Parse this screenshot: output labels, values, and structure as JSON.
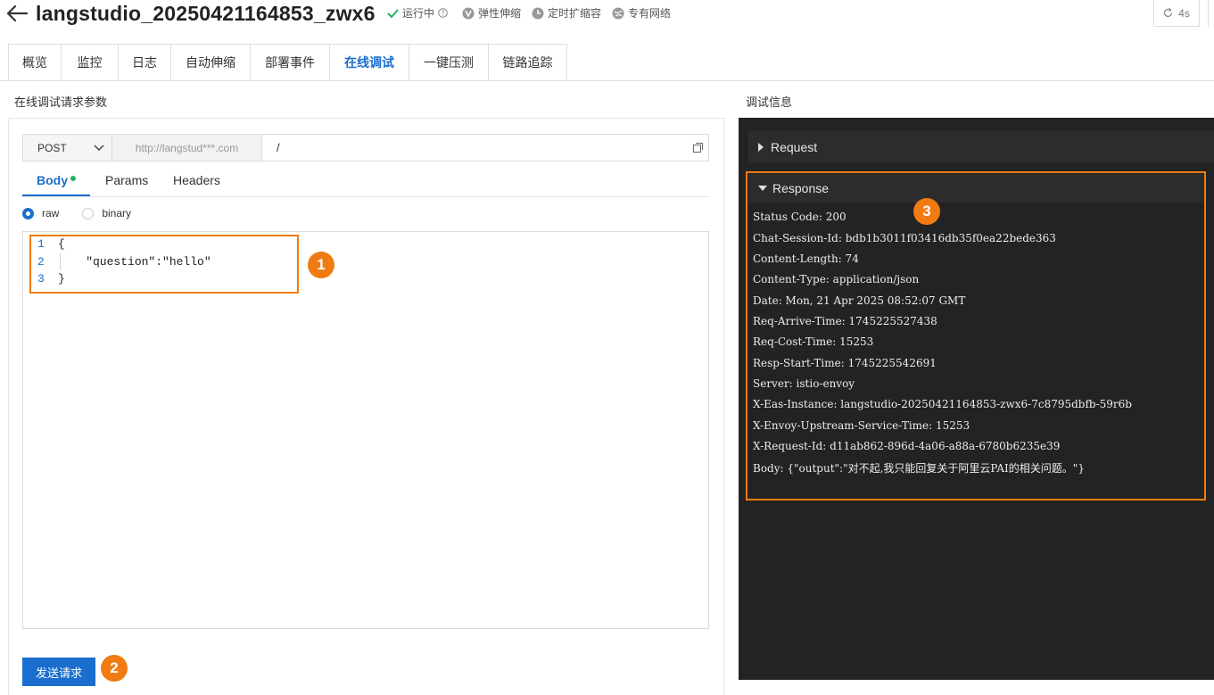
{
  "header": {
    "title": "langstudio_20250421164853_zwx6",
    "status": [
      {
        "label": "运行中",
        "icon": "check-icon"
      },
      {
        "label": "弹性伸缩",
        "icon": "scale-icon"
      },
      {
        "label": "定时扩缩容",
        "icon": "clock-icon"
      },
      {
        "label": "专有网络",
        "icon": "globe-icon"
      }
    ],
    "refresh_label": "4s"
  },
  "tabs": [
    {
      "label": "概览"
    },
    {
      "label": "监控"
    },
    {
      "label": "日志"
    },
    {
      "label": "自动伸缩"
    },
    {
      "label": "部署事件"
    },
    {
      "label": "在线调试",
      "active": true
    },
    {
      "label": "一键压测"
    },
    {
      "label": "链路追踪"
    }
  ],
  "left": {
    "title": "在线调试请求参数",
    "method": "POST",
    "host": "http://langstud***.com",
    "path": "/",
    "sub_tabs": [
      "Body",
      "Params",
      "Headers"
    ],
    "body_types": [
      "raw",
      "binary"
    ],
    "code": [
      {
        "num": "1",
        "text": "{"
      },
      {
        "num": "2",
        "text": "    \"question\":\"hello\""
      },
      {
        "num": "3",
        "text": "}"
      }
    ],
    "send_label": "发送请求"
  },
  "right": {
    "title": "调试信息",
    "request_label": "Request",
    "response_label": "Response",
    "response_lines": [
      "Status Code: 200",
      "Chat-Session-Id: bdb1b3011f03416db35f0ea22bede363",
      "Content-Length: 74",
      "Content-Type: application/json",
      "Date: Mon, 21 Apr 2025 08:52:07 GMT",
      "Req-Arrive-Time: 1745225527438",
      "Req-Cost-Time: 15253",
      "Resp-Start-Time: 1745225542691",
      "Server: istio-envoy",
      "X-Eas-Instance: langstudio-20250421164853-zwx6-7c8795dbfb-59r6b",
      "X-Envoy-Upstream-Service-Time: 15253",
      "X-Request-Id: d11ab862-896d-4a06-a88a-6780b6235e39",
      "Body: {\"output\":\"对不起,我只能回复关于阿里云PAI的相关问题。\"}"
    ]
  },
  "annotations": [
    "1",
    "2",
    "3"
  ],
  "colors": {
    "accent": "#1a6fce",
    "highlight": "#f07b12",
    "console_bg": "#232323"
  }
}
